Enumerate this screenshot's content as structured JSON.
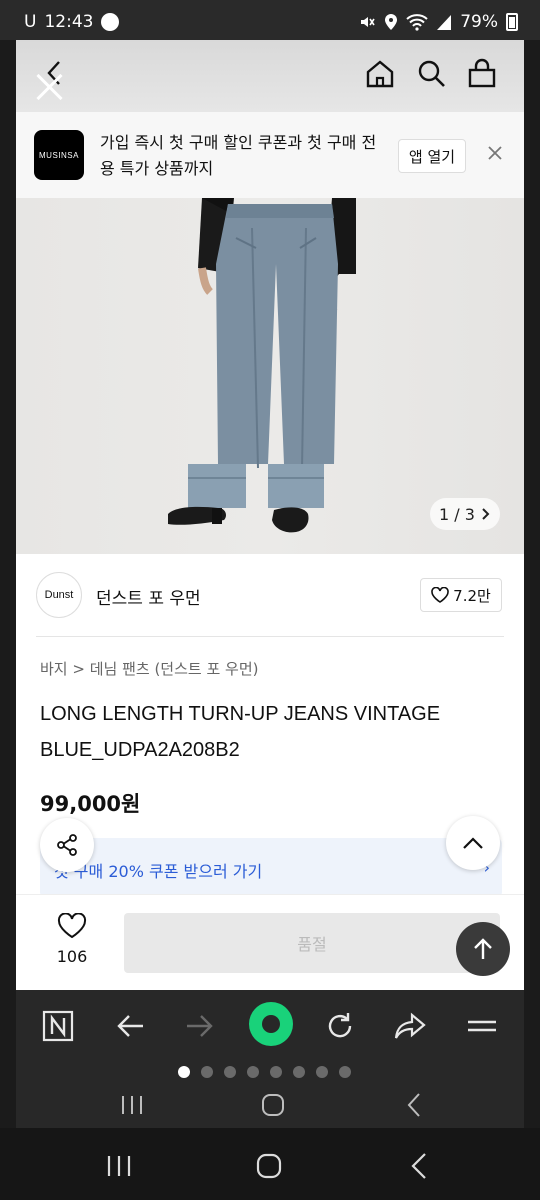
{
  "status_bar": {
    "carrier": "U",
    "time": "12:43",
    "battery": "79%"
  },
  "header": {
    "icons": [
      "close-icon",
      "back-icon",
      "home-icon",
      "search-icon",
      "shopping-bag-icon"
    ]
  },
  "banner": {
    "logo_text": "MUSINSA",
    "message": "가입 즉시 첫 구매 할인 쿠폰과 첫 구매 전용 특가 상품까지",
    "open_app_label": "앱 열기"
  },
  "gallery": {
    "counter": "1 / 3"
  },
  "brand": {
    "logo_text": "Dunst",
    "name": "던스트 포 우먼",
    "likes": "7.2만"
  },
  "product": {
    "breadcrumb": "바지 > 데님 팬츠 (던스트 포 우먼)",
    "title": "LONG LENGTH TURN-UP JEANS VINTAGE BLUE_UDPA2A208B2",
    "price": "99,000원",
    "coupon_text": "첫 구매 20% 쿠폰 받으러 가기"
  },
  "purchase_bar": {
    "wish_count": "106",
    "button_label": "품절"
  },
  "browser_toolbar": {
    "items": [
      "n-icon",
      "back-arrow-icon",
      "forward-arrow-icon",
      "home-icon",
      "refresh-icon",
      "share-icon",
      "menu-icon"
    ],
    "pages": 8,
    "active_page": 1
  },
  "colors": {
    "accent": "#19d27a",
    "coupon_text": "#2b5cd6",
    "toolbar": "#282828"
  }
}
